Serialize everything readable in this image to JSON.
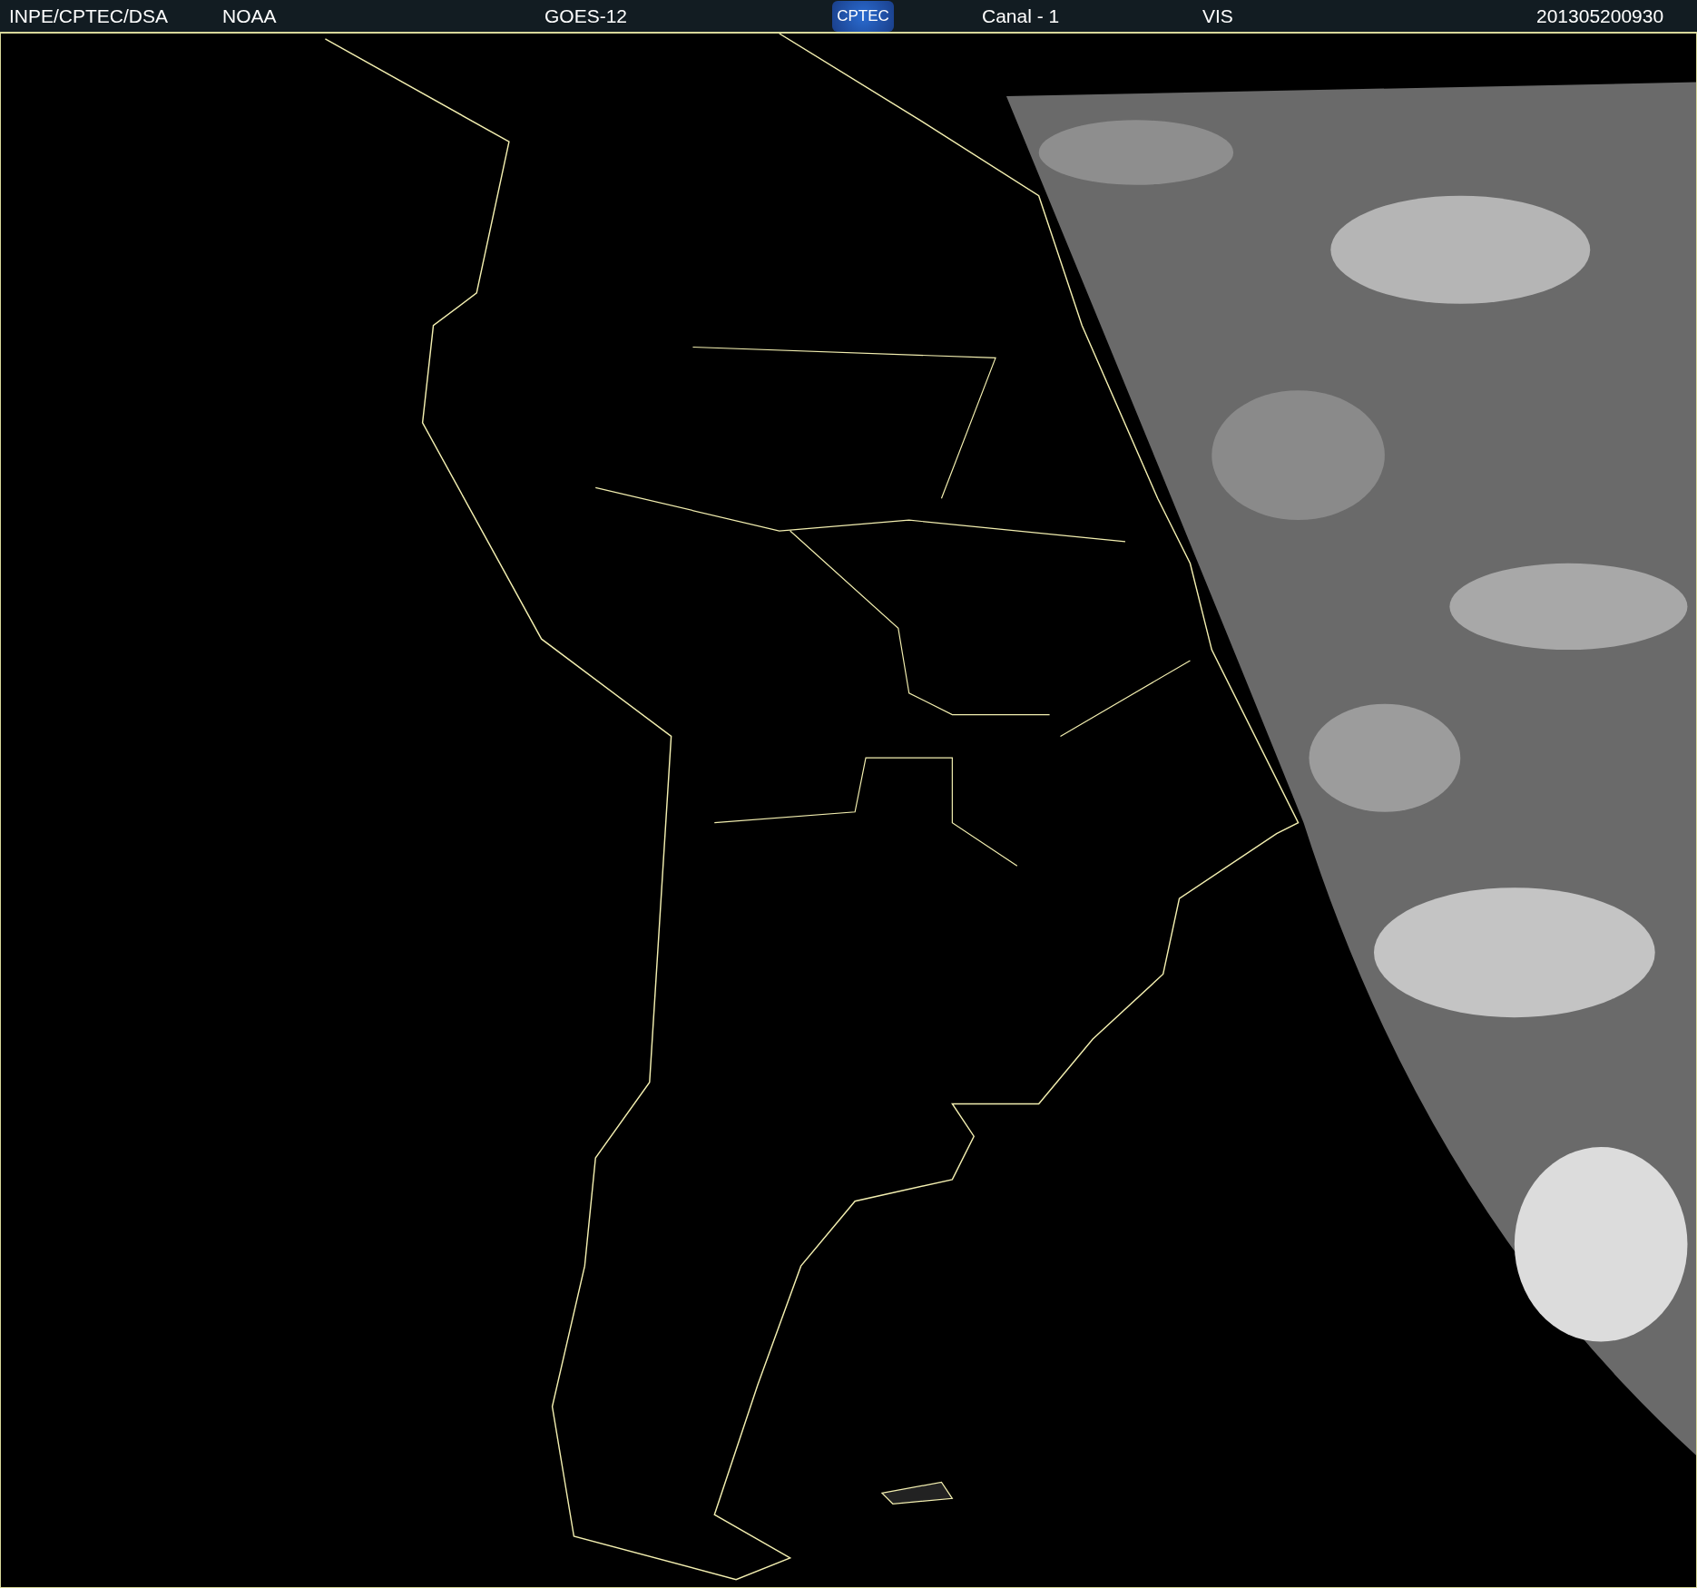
{
  "header": {
    "source": "INPE/CPTEC/DSA",
    "agency": "NOAA",
    "satellite": "GOES-12",
    "logo": "CPTEC",
    "channel": "Canal - 1",
    "band": "VIS",
    "timestamp": "201305200930"
  }
}
